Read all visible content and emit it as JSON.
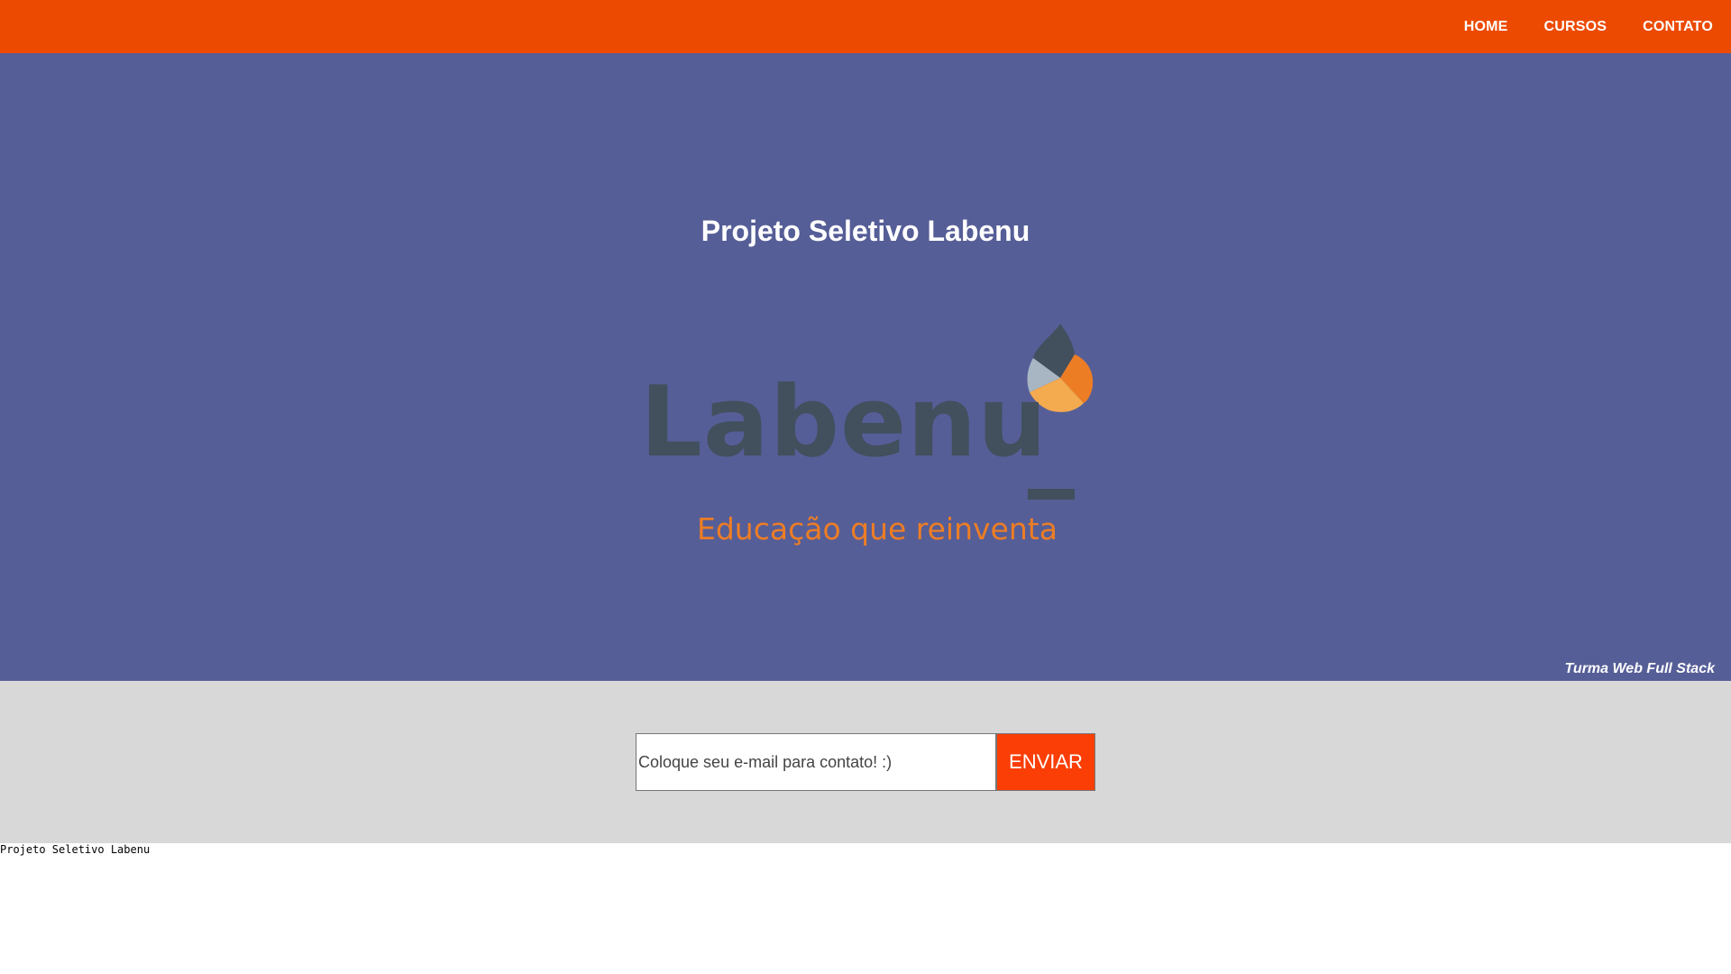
{
  "nav": {
    "items": [
      "HOME",
      "CURSOS",
      "CONTATO"
    ]
  },
  "hero": {
    "title": "Projeto Seletivo Labenu",
    "logo": {
      "wordmark": "Labenu",
      "tagline": "Educação que reinventa"
    },
    "footnote": "Turma Web Full Stack"
  },
  "contact": {
    "placeholder": "Coloque seu e-mail para contato! :)",
    "value": "",
    "button_label": "ENVIAR"
  },
  "footer": {
    "text": "Projeto Seletivo Labenu"
  },
  "colors": {
    "topbar": "#ec4a00",
    "hero_bg": "#565e97",
    "contact_bg": "#d8d8d8",
    "button": "#fa3e05",
    "logo_dark": "#424f5d",
    "logo_orange": "#ed7d25"
  }
}
